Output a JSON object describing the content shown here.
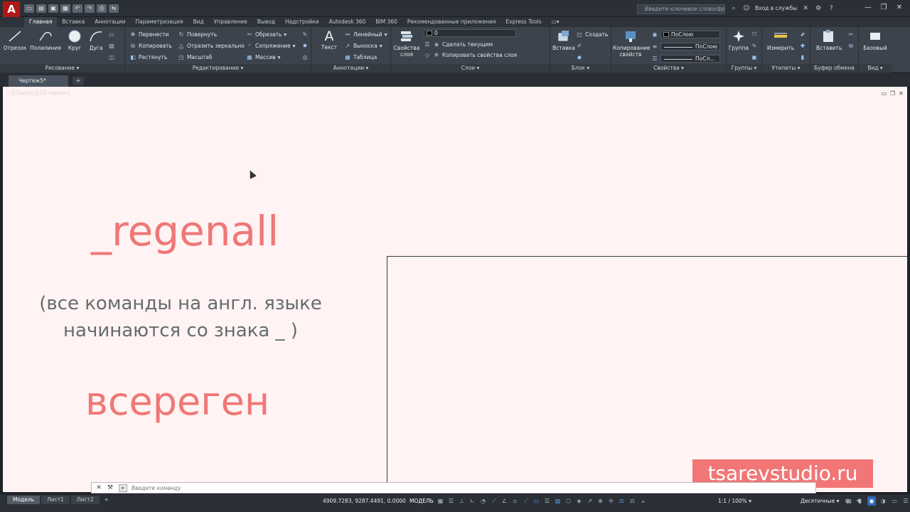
{
  "app": {
    "logo_letter": "A",
    "search_placeholder": "Введите ключевое слово/фразу",
    "signin_label": "Вход в службы",
    "qat_icons": [
      "new-file-icon",
      "open-icon",
      "save-icon",
      "save-as-icon",
      "undo-icon",
      "redo-icon",
      "plot-icon",
      "share-icon"
    ]
  },
  "ribbon_tabs": [
    "Главная",
    "Вставка",
    "Аннотации",
    "Параметризация",
    "Вид",
    "Управление",
    "Вывод",
    "Надстройки",
    "Autodesk 360",
    "BIM 360",
    "Рекомендованные приложения",
    "Express Tools"
  ],
  "ribbon": {
    "draw": {
      "title": "Рисование",
      "line": "Отрезок",
      "polyline": "Полилиния",
      "circle": "Круг",
      "arc": "Дуга"
    },
    "modify": {
      "title": "Редактирование",
      "move": "Перенести",
      "rotate": "Повернуть",
      "trim": "Обрезать",
      "copy": "Копировать",
      "mirror": "Отразить зеркально",
      "fillet": "Сопряжение",
      "stretch": "Растянуть",
      "scale": "Масштаб",
      "array": "Массив"
    },
    "annotation": {
      "title": "Аннотации",
      "text": "Текст",
      "linear": "Линейный",
      "leader": "Выноска",
      "table": "Таблица"
    },
    "layers": {
      "title": "Слои",
      "layer_props": "Свойства слоя",
      "current_layer": "0",
      "make_current": "Сделать текущим",
      "match_layer": "Копировать свойства слоя"
    },
    "block": {
      "title": "Блок",
      "insert": "Вставка",
      "create": "Создать"
    },
    "properties": {
      "title": "Свойства",
      "match_props": "Копирование свойств",
      "color": "ПоСлою",
      "linetype": "ПоСлою",
      "lineweight": "ПоСл..."
    },
    "groups": {
      "title": "Группы",
      "group": "Группа"
    },
    "utilities": {
      "title": "Утилиты",
      "measure": "Измерить"
    },
    "clipboard": {
      "title": "Буфер обмена",
      "paste": "Вставить"
    },
    "view": {
      "title": "Вид",
      "base": "Базовый"
    }
  },
  "document_tab": "Чертеж5*",
  "canvas": {
    "viewport_label": "[-][Сверху][2D-каркас]",
    "command_en": "_regenall",
    "note_line1": "(все команды на англ. языке",
    "note_line2": "начинаются со знака _ )",
    "command_ru": "всереген",
    "watermark": "tsarevstudio.ru"
  },
  "command_line": {
    "placeholder": "Введите команду"
  },
  "status": {
    "layout_tabs": [
      "Модель",
      "Лист1",
      "Лист2"
    ],
    "coords": "4909.7283, 9287.4491, 0.0000",
    "model": "МОДЕЛЬ",
    "scale": "1:1 / 100%",
    "units": "Десятичные"
  },
  "colors": {
    "canvas_bg": "#fff3f3",
    "accent_red": "#f07777",
    "ribbon_bg": "#3c434c"
  }
}
